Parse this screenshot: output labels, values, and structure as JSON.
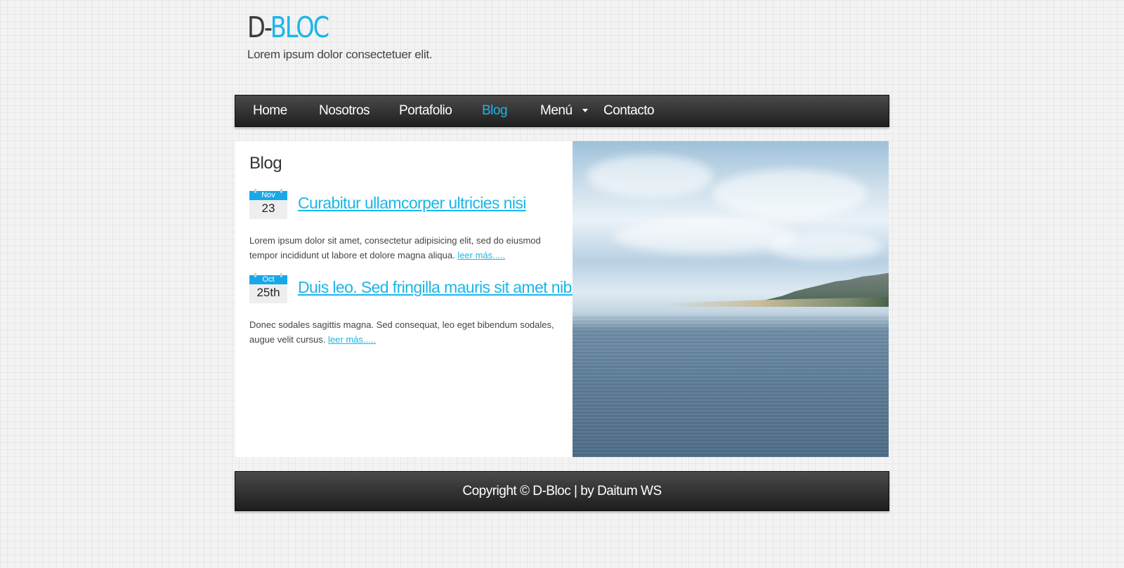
{
  "site": {
    "logo_part1": "D-",
    "logo_part2": "BLOC",
    "tagline": "Lorem ipsum dolor consectetuer elit."
  },
  "nav": {
    "items": [
      "Home",
      "Nosotros",
      "Portafolio",
      "Blog",
      "Menú",
      "Contacto"
    ],
    "active": "Blog"
  },
  "main": {
    "title": "Blog",
    "posts": [
      {
        "month": "Nov",
        "day": "23",
        "title": "Curabitur ullamcorper ultricies nisi",
        "text": "Lorem ipsum dolor sit amet, consectetur adipisicing elit, sed do eiusmod tempor incididunt ut labore et dolore magna aliqua.",
        "read_more": "leer más....."
      },
      {
        "month": "Oct",
        "day": "25th",
        "title": "Duis leo. Sed fringilla mauris sit amet nibh",
        "text": "Donec sodales sagittis magna. Sed consequat, leo eget bibendum sodales, augue velit cursus.",
        "read_more": "leer más....."
      }
    ]
  },
  "footer": {
    "copyright": "Copyright © D-Bloc | by Daitum WS"
  },
  "colors": {
    "accent": "#1ab6e8",
    "nav_bg": "#2e2e2e"
  }
}
